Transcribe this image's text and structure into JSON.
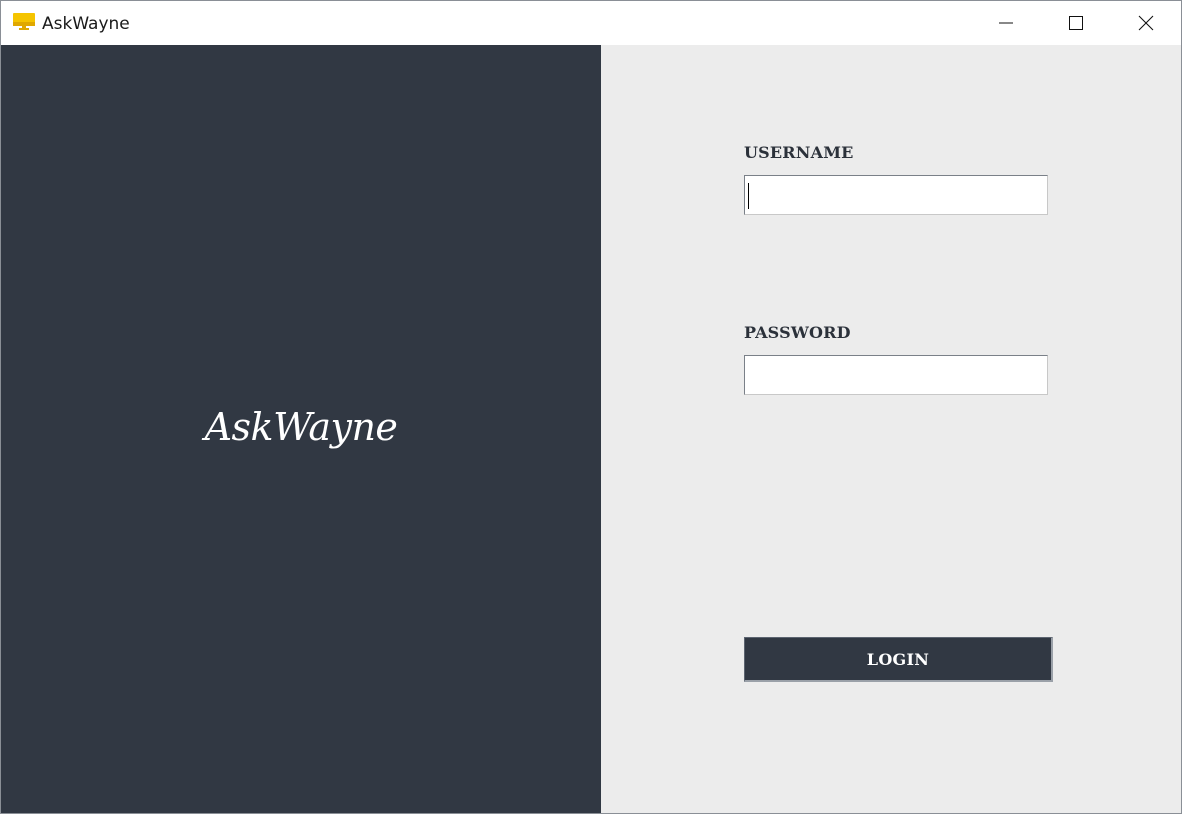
{
  "window": {
    "title": "AskWayne",
    "icon": "monitor-icon",
    "controls": [
      "minimize-icon",
      "maximize-icon",
      "close-icon"
    ]
  },
  "brand": {
    "text": "AskWayne"
  },
  "form": {
    "username_label": "USERNAME",
    "username_value": "",
    "password_label": "PASSWORD",
    "password_value": "",
    "login_label": "LOGIN"
  },
  "colors": {
    "sidebar_bg": "#313843",
    "form_bg": "#ececec",
    "button_bg": "#313843",
    "icon_accent": "#f5c400"
  }
}
